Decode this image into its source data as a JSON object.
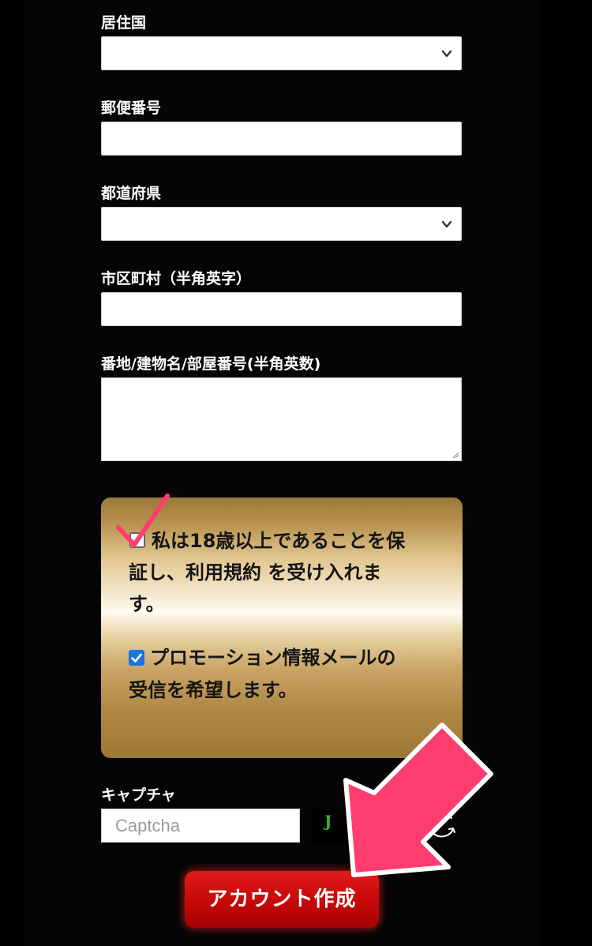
{
  "form": {
    "country_label": "居住国",
    "postal_label": "郵便番号",
    "prefecture_label": "都道府県",
    "city_label": "市区町村（半角英字）",
    "address_label": "番地/建物名/部屋番号(半角英数)"
  },
  "consent": {
    "age_line1": "私は18歳以上であることを保",
    "age_line2": "証し、利用規約 を受け入れま",
    "age_line3": "す。",
    "age_checked": false,
    "promo_line1": "プロモーション情報メールの",
    "promo_line2": "受信を希望します。",
    "promo_checked": true
  },
  "captcha": {
    "label": "キャプチャ",
    "placeholder": "Captcha",
    "image_text": "J"
  },
  "submit": {
    "label": "アカウント作成"
  },
  "colors": {
    "annotation": "#ff3d6e",
    "accent": "#d10f0f",
    "gold": "#c9a465"
  },
  "icons": {
    "select_arrow": "chevron-down-icon",
    "refresh": "refresh-icon",
    "annotation_check": "checkmark-icon",
    "annotation_arrow": "arrow-icon"
  }
}
